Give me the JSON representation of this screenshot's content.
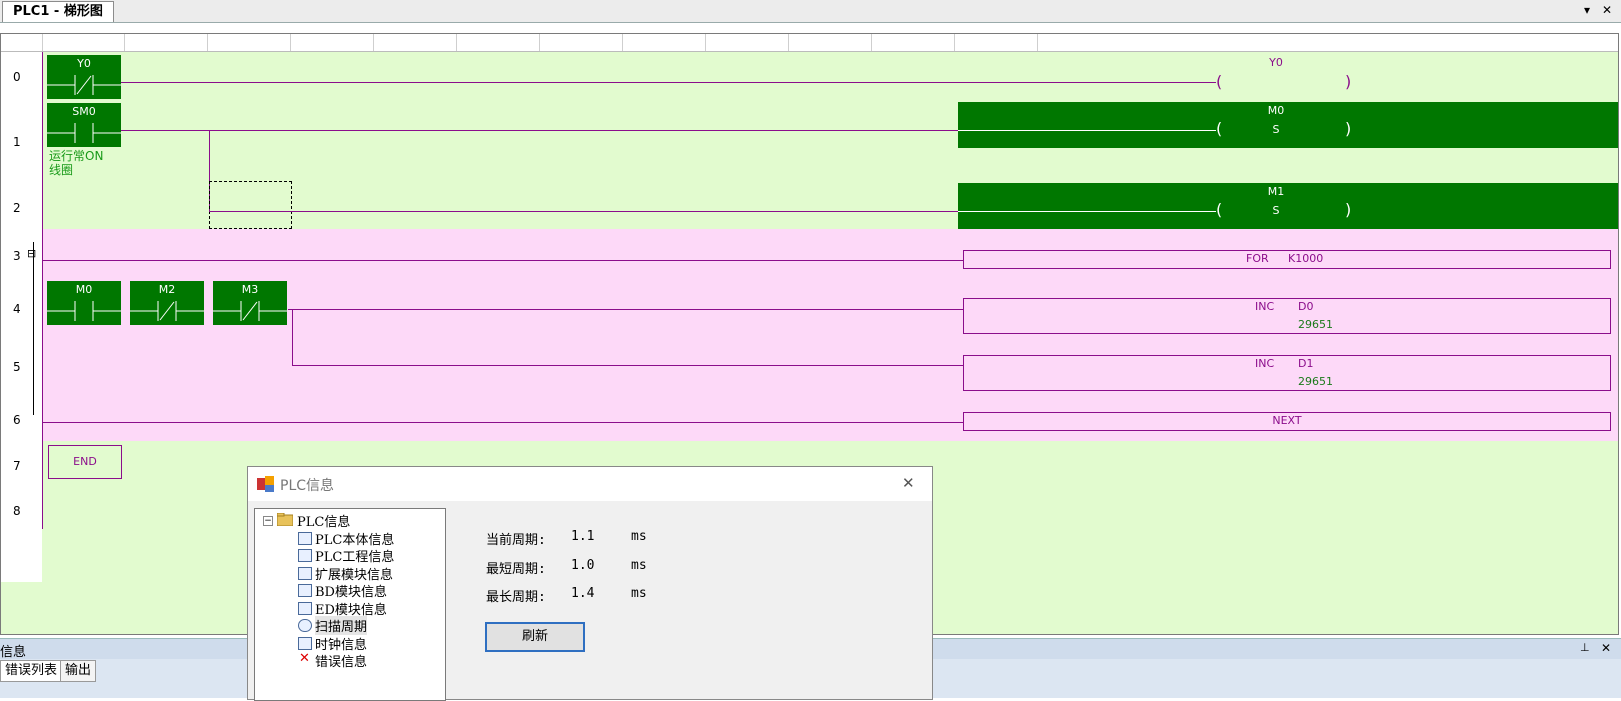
{
  "window": {
    "tab_title": "PLC1 - 梯形图",
    "dropdown_glyph": "▾",
    "close_glyph": "✕"
  },
  "ladder": {
    "row_numbers": [
      "0",
      "1",
      "2",
      "3",
      "4",
      "5",
      "6",
      "7",
      "8"
    ],
    "fold_marker": "⊟",
    "contacts": {
      "y0": "Y0",
      "sm0": "SM0",
      "m0": "M0",
      "m2": "M2",
      "m3": "M3"
    },
    "sm0_comment_line1": "运行常ON",
    "sm0_comment_line2": "线圈",
    "coils": {
      "y0": "Y0",
      "m0": "M0",
      "m0_mode": "S",
      "m1": "M1",
      "m1_mode": "S"
    },
    "instructions": {
      "for_op": "FOR",
      "for_arg": "K1000",
      "inc1_op": "INC",
      "inc1_arg": "D0",
      "inc1_value": "29651",
      "inc2_op": "INC",
      "inc2_arg": "D1",
      "inc2_value": "29651",
      "next": "NEXT",
      "end": "END"
    }
  },
  "dialog": {
    "title": "PLC信息",
    "close_glyph": "✕",
    "tree_root": "PLC信息",
    "tree_items": [
      "PLC本体信息",
      "PLC工程信息",
      "扩展模块信息",
      "BD模块信息",
      "ED模块信息",
      "扫描周期",
      "时钟信息",
      "错误信息"
    ],
    "current_label": "当前周期:",
    "current_value": "1.1",
    "min_label": "最短周期:",
    "min_value": "1.0",
    "max_label": "最长周期:",
    "max_value": "1.4",
    "unit": "ms",
    "refresh_button": "刷新"
  },
  "bottom_panel": {
    "title": "信息",
    "pin_glyph": "⊥",
    "close_glyph": "✕",
    "tabs": [
      "错误列表",
      "输出"
    ]
  },
  "colors": {
    "contact_green": "#007700",
    "wire_purple": "#8b0d8b",
    "ladder_bg": "#e2fbcf",
    "loop_bg": "#fdd9f8"
  }
}
